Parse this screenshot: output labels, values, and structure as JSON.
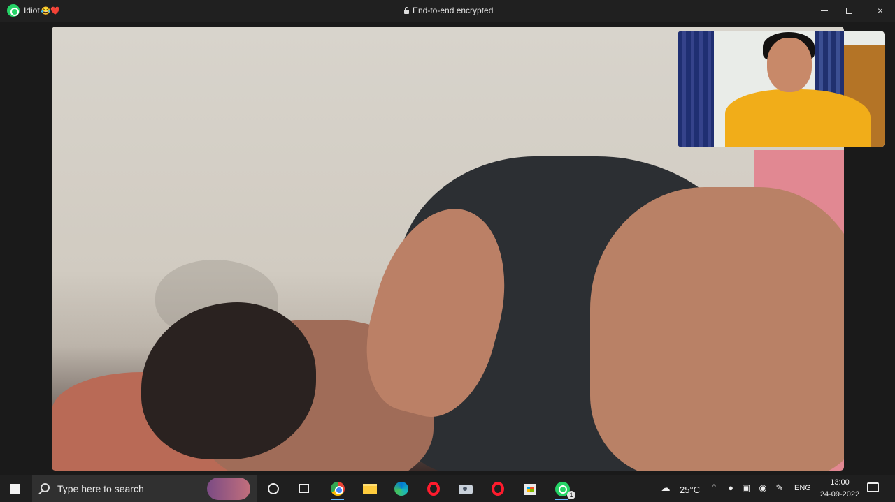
{
  "titlebar": {
    "contact_name": "Idiot",
    "name_emojis": "😂❤️",
    "encryption_label": "End-to-end encrypted",
    "minimize_label": "",
    "restore_label": "",
    "close_label": "×",
    "app_icon": "whatsapp-icon"
  },
  "call": {
    "remote_video": "remote-video-feed",
    "self_video": "self-video-preview"
  },
  "taskbar": {
    "search_placeholder": "Type here to search",
    "weather": "25°C",
    "language": "ENG",
    "time": "13:00",
    "date": "24-09-2022",
    "whatsapp_badge": "1",
    "icons": [
      "start-icon",
      "search-icon",
      "cortana-icon",
      "task-view-icon",
      "chrome-icon",
      "file-explorer-icon",
      "edge-icon",
      "opera-icon",
      "camera-icon",
      "microsoft-store-icon",
      "whatsapp-icon"
    ]
  },
  "colors": {
    "whatsapp": "#25d366",
    "taskbar": "#1f1f1f",
    "titlebar": "#202020"
  }
}
